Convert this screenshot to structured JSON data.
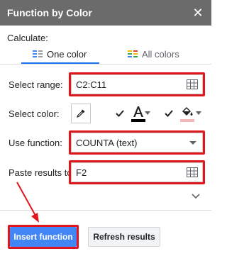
{
  "window": {
    "title": "Function by Color"
  },
  "calculate_label": "Calculate:",
  "tabs": [
    {
      "label": "One color",
      "active": true
    },
    {
      "label": "All colors",
      "active": false
    }
  ],
  "range": {
    "label": "Select range:",
    "value": "C2:C11"
  },
  "color": {
    "label": "Select color:",
    "font_color": "#000000",
    "fill_color": "#f4b8b8"
  },
  "function": {
    "label": "Use function:",
    "value": "COUNTA (text)"
  },
  "paste": {
    "label": "Paste results to:",
    "value": "F2"
  },
  "buttons": {
    "insert": "Insert function",
    "refresh": "Refresh results"
  },
  "colors": {
    "titlebar": "#6b6b6b",
    "accent": "#4285f4",
    "highlight": "#e0161c"
  }
}
